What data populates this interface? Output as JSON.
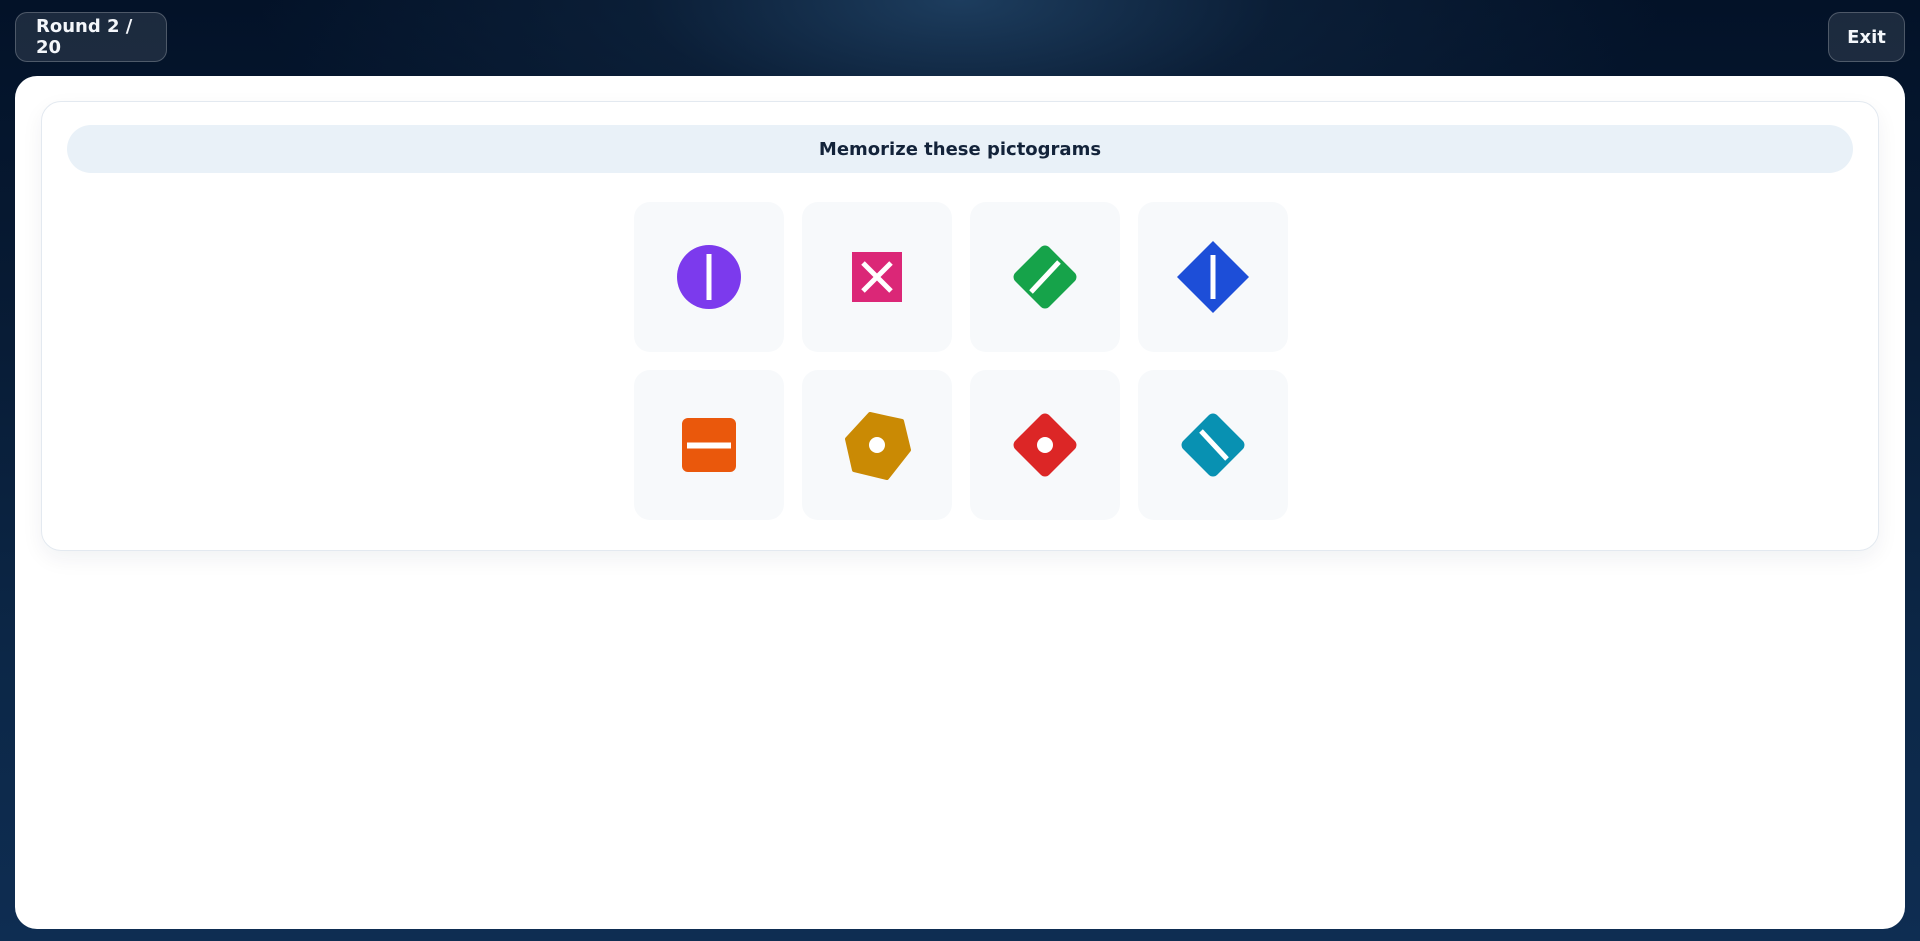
{
  "header": {
    "round_label": "Round 2 / 20",
    "exit_label": "Exit"
  },
  "prompt": {
    "text": "Memorize these pictograms"
  },
  "pictograms": [
    {
      "shape": "circle",
      "mark": "vertical-line",
      "color": "#7c3aed",
      "icon": "purple-circle-vertical-line-icon"
    },
    {
      "shape": "square",
      "mark": "cross",
      "color": "#db2777",
      "icon": "pink-square-cross-icon"
    },
    {
      "shape": "rounded-diamond",
      "mark": "diagonal-line",
      "color": "#16a34a",
      "icon": "green-diamond-diagonal-line-icon"
    },
    {
      "shape": "diamond",
      "mark": "vertical-line",
      "color": "#1d4ed8",
      "icon": "blue-diamond-vertical-line-icon"
    },
    {
      "shape": "rounded-square",
      "mark": "horizontal-line",
      "color": "#ea580c",
      "icon": "orange-square-horizontal-line-icon"
    },
    {
      "shape": "hexagon",
      "mark": "dot",
      "color": "#ca8a04",
      "icon": "gold-hexagon-dot-icon"
    },
    {
      "shape": "rounded-diamond",
      "mark": "dot",
      "color": "#dc2626",
      "icon": "red-diamond-dot-icon"
    },
    {
      "shape": "rounded-diamond",
      "mark": "back-diagonal-line",
      "color": "#0891b2",
      "icon": "teal-diamond-back-diagonal-line-icon"
    }
  ]
}
